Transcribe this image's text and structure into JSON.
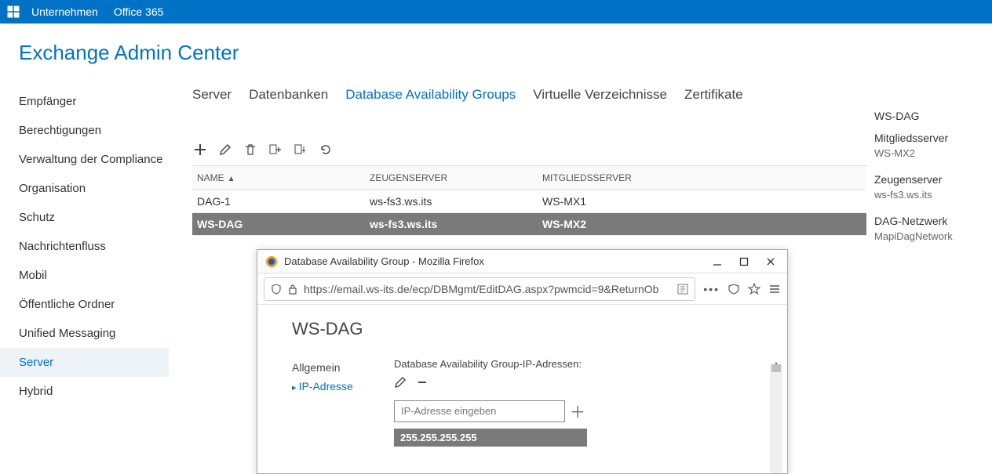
{
  "topbar": {
    "link_company": "Unternehmen",
    "link_office": "Office 365"
  },
  "page_title": "Exchange Admin Center",
  "leftnav": [
    {
      "label": "Empfänger",
      "active": false
    },
    {
      "label": "Berechtigungen",
      "active": false
    },
    {
      "label": "Verwaltung der Compliance",
      "active": false
    },
    {
      "label": "Organisation",
      "active": false
    },
    {
      "label": "Schutz",
      "active": false
    },
    {
      "label": "Nachrichtenfluss",
      "active": false
    },
    {
      "label": "Mobil",
      "active": false
    },
    {
      "label": "Öffentliche Ordner",
      "active": false
    },
    {
      "label": "Unified Messaging",
      "active": false
    },
    {
      "label": "Server",
      "active": true
    },
    {
      "label": "Hybrid",
      "active": false
    }
  ],
  "subtabs": [
    {
      "label": "Server",
      "active": false
    },
    {
      "label": "Datenbanken",
      "active": false
    },
    {
      "label": "Database Availability Groups",
      "active": true
    },
    {
      "label": "Virtuelle Verzeichnisse",
      "active": false
    },
    {
      "label": "Zertifikate",
      "active": false
    }
  ],
  "grid": {
    "headers": {
      "name": "NAME",
      "witness": "ZEUGENSERVER",
      "members": "MITGLIEDSSERVER"
    },
    "rows": [
      {
        "name": "DAG-1",
        "witness": "ws-fs3.ws.its",
        "members": "WS-MX1",
        "selected": false
      },
      {
        "name": "WS-DAG",
        "witness": "ws-fs3.ws.its",
        "members": "WS-MX2",
        "selected": true
      }
    ]
  },
  "detail": {
    "name": "WS-DAG",
    "members_label": "Mitgliedsserver",
    "members_value": "WS-MX2",
    "witness_label": "Zeugenserver",
    "witness_value": "ws-fs3.ws.its",
    "network_label": "DAG-Netzwerk",
    "network_value": "MapiDagNetwork"
  },
  "popup": {
    "window_title": "Database Availability Group - Mozilla Firefox",
    "url_display": "https://email.ws-its.de/ecp/DBMgmt/EditDAG.aspx?pwmcid=9&ReturnOb",
    "dag_title": "WS-DAG",
    "menu_general": "Allgemein",
    "menu_ip": "IP-Adresse",
    "form_label": "Database Availability Group-IP-Adressen:",
    "ip_placeholder": "IP-Adresse eingeben",
    "ip_list": [
      "255.255.255.255"
    ]
  }
}
